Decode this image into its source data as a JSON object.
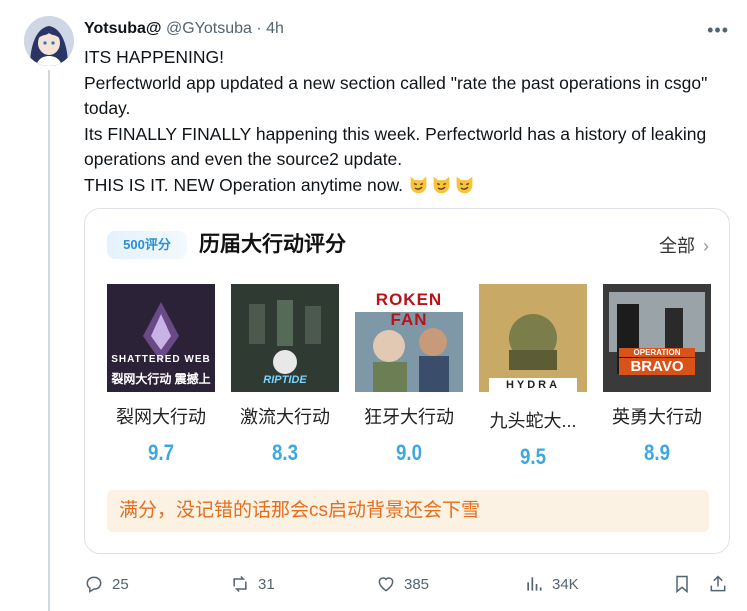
{
  "author": {
    "name": "Yotsuba@",
    "handle": "@GYotsuba",
    "separator": "·",
    "time": "4h"
  },
  "tweet": {
    "line1": "ITS HAPPENING!",
    "line2": "Perfectworld app updated a new section called \"rate the past operations in csgo\" today.",
    "line3": "Its FINALLY FINALLY happening this week. Perfectworld has a history of leaking operations and even the source2 update.",
    "line4": "THIS IS IT. NEW Operation anytime now.",
    "emojis": [
      "smirking-cat-icon",
      "smirking-cat-icon",
      "smirking-cat-icon"
    ]
  },
  "card": {
    "badge": "500评分",
    "title": "历届大行动评分",
    "all_label": "全部",
    "footer_note": "满分，没记错的话那会cs启动背景还会下雪",
    "operations": [
      {
        "name": "裂网大行动",
        "score": "9.7",
        "art_text": "SHATTERED WEB",
        "art_sub": "裂网大行动 震撼上",
        "color": "#2b2238"
      },
      {
        "name": "激流大行动",
        "score": "8.3",
        "art_text": "RIPTIDE",
        "color": "#2f3a33"
      },
      {
        "name": "狂牙大行动",
        "score": "9.0",
        "art_text": "ROKEN FAN",
        "color": "#5a7a8c"
      },
      {
        "name": "九头蛇大...",
        "score": "9.5",
        "art_text": "HYDRA",
        "color": "#b89a55"
      },
      {
        "name": "英勇大行动",
        "score": "8.9",
        "art_text": "BRAVO",
        "art_sub": "OPERATION",
        "color": "#3a3a3a"
      }
    ]
  },
  "actions": {
    "replies": "25",
    "retweets": "31",
    "likes": "385",
    "views": "34K"
  },
  "colors": {
    "score": "#3fa7e0",
    "note_text": "#e46d1e",
    "note_bg": "#fbf2e3",
    "muted": "#536471"
  }
}
